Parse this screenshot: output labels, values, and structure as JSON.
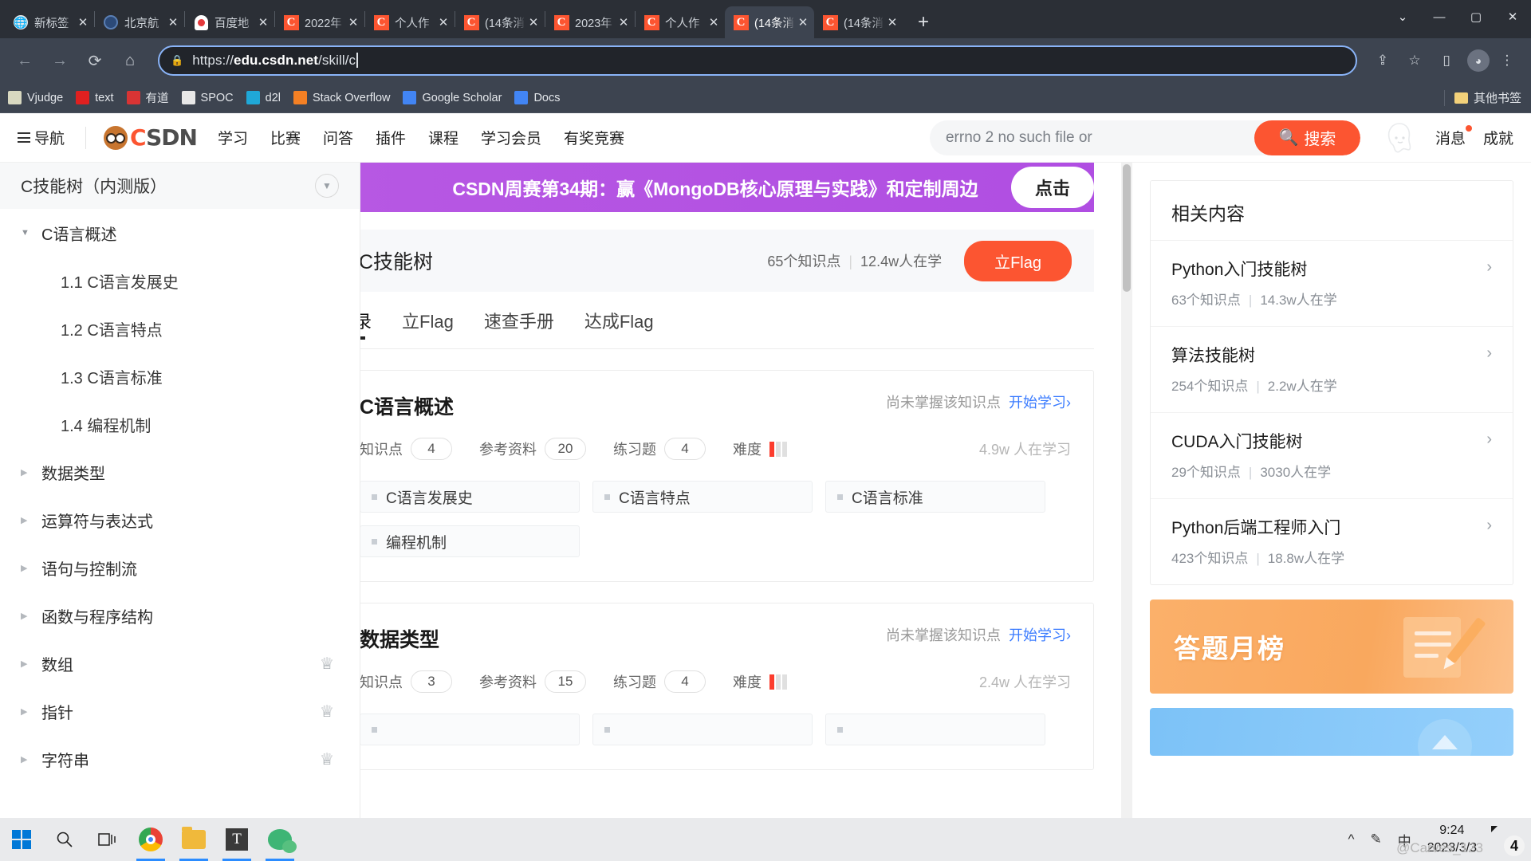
{
  "browser": {
    "tabs": [
      {
        "title": "新标签",
        "favicon": "globe-icon",
        "active": false
      },
      {
        "title": "北京航",
        "favicon": "circle-icon",
        "active": false
      },
      {
        "title": "百度地",
        "favicon": "baidu-icon",
        "active": false
      },
      {
        "title": "2022年",
        "favicon": "csdn-icon",
        "active": false
      },
      {
        "title": "个人作",
        "favicon": "csdn-icon",
        "active": false
      },
      {
        "title": "(14条消",
        "favicon": "csdn-icon",
        "active": false
      },
      {
        "title": "2023年",
        "favicon": "csdn-icon",
        "active": false
      },
      {
        "title": "个人作",
        "favicon": "csdn-icon",
        "active": false
      },
      {
        "title": "(14条消",
        "favicon": "csdn-icon",
        "active": true
      },
      {
        "title": "(14条消",
        "favicon": "csdn-icon",
        "active": false
      }
    ],
    "close_label": "✕",
    "new_tab_label": "+",
    "window_controls": {
      "minimize": "—",
      "maximize": "▢",
      "close": "✕",
      "chevron": "⌄"
    },
    "nav": {
      "back": "←",
      "forward": "→",
      "reload": "⟳",
      "home": "⌂"
    },
    "omnibox": {
      "lock_icon": "lock-icon",
      "url_prefix": "https://",
      "url_domain": "edu.csdn.net",
      "url_path": "/skill/c"
    },
    "toolbar_icons": {
      "share": "⇪",
      "bookmark": "☆",
      "sidepanel": "▯",
      "profile": "◕",
      "menu": "⋮"
    },
    "bookmarks": [
      {
        "label": "Vjudge",
        "icon": "vjudge-icon",
        "color": "#d8d8c0"
      },
      {
        "label": "text",
        "icon": "text-icon",
        "color": "#e02020"
      },
      {
        "label": "有道",
        "icon": "youdao-icon",
        "color": "#d93434"
      },
      {
        "label": "SPOC",
        "icon": "spoc-icon",
        "color": "#e8e8e8"
      },
      {
        "label": "d2l",
        "icon": "d2l-icon",
        "color": "#1fa8d8"
      },
      {
        "label": "Stack Overflow",
        "icon": "stackoverflow-icon",
        "color": "#f48024"
      },
      {
        "label": "Google Scholar",
        "icon": "scholar-icon",
        "color": "#4285f4"
      },
      {
        "label": "Docs",
        "icon": "docs-icon",
        "color": "#4285f4"
      }
    ],
    "bookmarks_other": {
      "label": "其他书签",
      "icon": "folder-icon"
    }
  },
  "site_nav": {
    "menu_label": "导航",
    "logo_c": "C",
    "logo_sdn": "SDN",
    "links": [
      "学习",
      "比赛",
      "问答",
      "插件",
      "课程",
      "学习会员",
      "有奖竞赛"
    ],
    "search": {
      "placeholder": "errno 2 no such file or",
      "button_label": "搜索",
      "button_icon": "search-icon"
    },
    "right_links": [
      "消息",
      "成就"
    ]
  },
  "sidebar": {
    "title": "C技能树（内测版）",
    "collapse_icon": "chevron-down-icon",
    "items": [
      {
        "label": "C语言概述",
        "level": 1,
        "expanded": true,
        "crown": false
      },
      {
        "label": "1.1 C语言发展史",
        "level": 2,
        "expanded": false,
        "crown": false
      },
      {
        "label": "1.2 C语言特点",
        "level": 2,
        "expanded": false,
        "crown": false
      },
      {
        "label": "1.3 C语言标准",
        "level": 2,
        "expanded": false,
        "crown": false
      },
      {
        "label": "1.4 编程机制",
        "level": 2,
        "expanded": false,
        "crown": false
      },
      {
        "label": "数据类型",
        "level": 1,
        "expanded": false,
        "crown": false
      },
      {
        "label": "运算符与表达式",
        "level": 1,
        "expanded": false,
        "crown": false
      },
      {
        "label": "语句与控制流",
        "level": 1,
        "expanded": false,
        "crown": false
      },
      {
        "label": "函数与程序结构",
        "level": 1,
        "expanded": false,
        "crown": false
      },
      {
        "label": "数组",
        "level": 1,
        "expanded": false,
        "crown": true
      },
      {
        "label": "指针",
        "level": 1,
        "expanded": false,
        "crown": true
      },
      {
        "label": "字符串",
        "level": 1,
        "expanded": false,
        "crown": true
      }
    ],
    "crown_icon": "crown-icon"
  },
  "main": {
    "promo": {
      "text": "CSDN周赛第34期：赢《MongoDB核心原理与实践》和定制周边",
      "button_label": "点击"
    },
    "header": {
      "title": "C技能树",
      "knowledge_points": "65个知识点",
      "separator": "|",
      "learners": "12.4w人在学",
      "action_label": "立Flag"
    },
    "tabs": [
      {
        "label": "目录",
        "active": true
      },
      {
        "label": "立Flag",
        "active": false
      },
      {
        "label": "速查手册",
        "active": false
      },
      {
        "label": "达成Flag",
        "active": false
      }
    ],
    "sections": [
      {
        "title": "C语言概述",
        "status": "尚未掌握该知识点",
        "start_label": "开始学习",
        "start_chevron": "›",
        "stats": [
          {
            "label": "知识点",
            "value": "4"
          },
          {
            "label": "参考资料",
            "value": "20"
          },
          {
            "label": "练习题",
            "value": "4"
          }
        ],
        "difficulty_label": "难度",
        "difficulty_level": 1,
        "difficulty_total": 3,
        "learners": "4.9w 人在学习",
        "chips": [
          "C语言发展史",
          "C语言特点",
          "C语言标准",
          "编程机制"
        ]
      },
      {
        "title": "数据类型",
        "status": "尚未掌握该知识点",
        "start_label": "开始学习",
        "start_chevron": "›",
        "stats": [
          {
            "label": "知识点",
            "value": "3"
          },
          {
            "label": "参考资料",
            "value": "15"
          },
          {
            "label": "练习题",
            "value": "4"
          }
        ],
        "difficulty_label": "难度",
        "difficulty_level": 1,
        "difficulty_total": 3,
        "learners": "2.4w 人在学习",
        "chips": [
          "",
          "",
          ""
        ]
      }
    ]
  },
  "rail": {
    "title": "相关内容",
    "chevron": "›",
    "items": [
      {
        "title": "Python入门技能树",
        "points": "63个知识点",
        "sep": "|",
        "learners": "14.3w人在学"
      },
      {
        "title": "算法技能树",
        "points": "254个知识点",
        "sep": "|",
        "learners": "2.2w人在学"
      },
      {
        "title": "CUDA入门技能树",
        "points": "29个知识点",
        "sep": "|",
        "learners": "3030人在学"
      },
      {
        "title": "Python后端工程师入门",
        "points": "423个知识点",
        "sep": "|",
        "learners": "18.8w人在学"
      }
    ],
    "banners": [
      {
        "title": "答题月榜",
        "color": "#f9a85e",
        "art": "pencil-paper-icon"
      },
      {
        "title": "",
        "color": "#7cc2f7",
        "art": "trophy-icon"
      }
    ]
  },
  "taskbar": {
    "items": [
      {
        "name": "start",
        "icon": "windows-icon"
      },
      {
        "name": "search",
        "icon": "search-icon"
      },
      {
        "name": "task-view",
        "icon": "taskview-icon"
      },
      {
        "name": "chrome",
        "icon": "chrome-icon",
        "active": true
      },
      {
        "name": "file-explorer",
        "icon": "folder-icon",
        "active": true
      },
      {
        "name": "typora",
        "icon": "t-icon",
        "active": true
      },
      {
        "name": "wechat",
        "icon": "wechat-icon",
        "active": true
      }
    ],
    "tray": {
      "chevron": "^",
      "pen": "✎",
      "ime": "中"
    },
    "clock": {
      "time": "9:24",
      "date": "2023/3/3"
    },
    "notification_count": "4",
    "watermark": "@Carves_123"
  }
}
